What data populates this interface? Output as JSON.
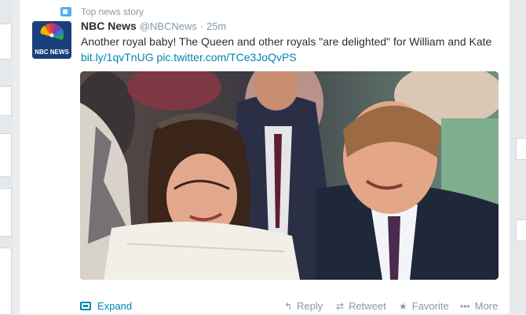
{
  "context": {
    "label": "Top news story"
  },
  "tweet": {
    "name": "NBC News",
    "handle": "@NBCNews",
    "separator": "·",
    "time": "25m",
    "text": "Another royal baby! The Queen and other royals \"are delighted\" for William and Kate",
    "link1": "bit.ly/1qvTnUG",
    "link2": "pic.twitter.com/TCe3JoQvPS",
    "avatar_label": "NBC NEWS"
  },
  "actions": {
    "expand": "Expand",
    "reply": "Reply",
    "retweet": "Retweet",
    "favorite": "Favorite",
    "more": "More"
  },
  "icons": {
    "context": "top-news-icon",
    "reply": "reply-icon",
    "retweet": "retweet-icon",
    "favorite": "star-icon",
    "more": "more-dots-icon",
    "expand": "expand-media-icon"
  },
  "colors": {
    "link": "#0084b4",
    "muted": "#8899a6",
    "text": "#292f33",
    "accent": "#55acee"
  }
}
